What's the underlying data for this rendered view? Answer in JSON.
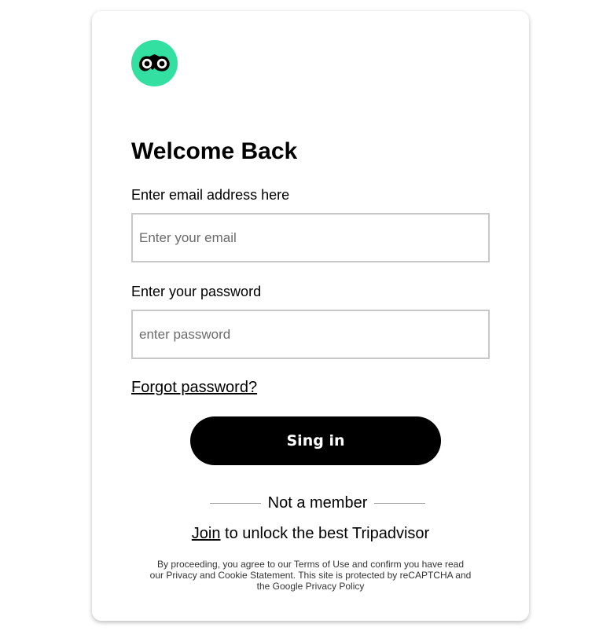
{
  "brand": {
    "logo_icon": "owl-eyes-icon",
    "accent_color": "#34e0a1"
  },
  "heading": "Welcome Back",
  "email": {
    "label": "Enter email address here",
    "placeholder": "Enter your email",
    "value": ""
  },
  "password": {
    "label": "Enter your password",
    "placeholder": "enter password",
    "value": ""
  },
  "forgot_link": "Forgot password?",
  "signin_button": "Sing in",
  "divider_text": "Not a member",
  "join": {
    "link": "Join",
    "rest": " to unlock the best Tripadvisor"
  },
  "legal_text": "By proceeding, you agree to our Terms of Use and confirm you have read our Privacy and Cookie Statement. This site is protected by reCAPTCHA and the Google Privacy Policy"
}
